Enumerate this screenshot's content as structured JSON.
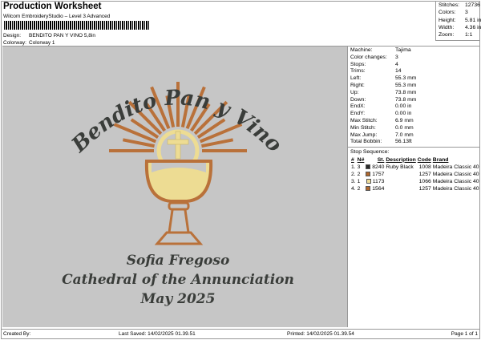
{
  "header": {
    "title": "Production Worksheet",
    "software": "Wilcom EmbroideryStudio – Level 3 Advanced",
    "design_label": "Design:",
    "design_value": "BENDITO PAN Y VINO 5,8in",
    "colorway_label": "Colorway:",
    "colorway_value": "Colorway 1"
  },
  "stats": [
    {
      "label": "Stitches:",
      "value": "12736"
    },
    {
      "label": "Colors:",
      "value": "3"
    },
    {
      "label": "Height:",
      "value": "5.81 in"
    },
    {
      "label": "Width:",
      "value": "4.36 in"
    },
    {
      "label": "Zoom:",
      "value": "1:1"
    }
  ],
  "info": [
    {
      "label": "Machine:",
      "value": "Tajima"
    },
    {
      "label": "Color changes:",
      "value": "3"
    },
    {
      "label": "Stops:",
      "value": "4"
    },
    {
      "label": "Trims:",
      "value": "14"
    },
    {
      "label": "Left:",
      "value": "55.3 mm"
    },
    {
      "label": "Right:",
      "value": "55.3 mm"
    },
    {
      "label": "Up:",
      "value": "73.8 mm"
    },
    {
      "label": "Down:",
      "value": "73.8 mm"
    },
    {
      "label": "EndX:",
      "value": "0.00 in"
    },
    {
      "label": "EndY:",
      "value": "0.00 in"
    },
    {
      "label": "Max Stitch:",
      "value": "6.9 mm"
    },
    {
      "label": "Min Stitch:",
      "value": "0.0 mm"
    },
    {
      "label": "Max Jump:",
      "value": "7.0 mm"
    },
    {
      "label": "Total Bobbin:",
      "value": "56.13ft"
    }
  ],
  "stop_sequence": {
    "title": "Stop Sequence:",
    "columns": [
      "#",
      "N#",
      "St.",
      "Description",
      "Code",
      "Brand"
    ],
    "rows": [
      {
        "num": "1.",
        "n": "3",
        "color": "#2a2a2a",
        "st": "8240",
        "desc": "Ruby Black",
        "code": "1008",
        "brand": "Madeira Classic 40"
      },
      {
        "num": "2.",
        "n": "2",
        "color": "#b0682e",
        "st": "1757",
        "desc": "",
        "code": "1257",
        "brand": "Madeira Classic 40"
      },
      {
        "num": "3.",
        "n": "1",
        "color": "#eedd9a",
        "st": "1173",
        "desc": "",
        "code": "1066",
        "brand": "Madeira Classic 40"
      },
      {
        "num": "4.",
        "n": "2",
        "color": "#b0682e",
        "st": "1564",
        "desc": "",
        "code": "1257",
        "brand": "Madeira Classic 40"
      }
    ]
  },
  "design": {
    "arc_text": "Bendito Pan y Vino",
    "line1": "Sofia Fregoso",
    "line2": "Cathedral of the Annunciation",
    "line3": "May 2025",
    "colors": {
      "text": "#3a3d3a",
      "copper": "#b9713a",
      "gold": "#eddc93",
      "background": "#c6c6c6"
    }
  },
  "footer": {
    "created": "Created By:",
    "saved": "Last Saved: 14/02/2025 01.39.51",
    "printed": "Printed: 14/02/2025 01.39.54",
    "page": "Page 1 of 1"
  }
}
